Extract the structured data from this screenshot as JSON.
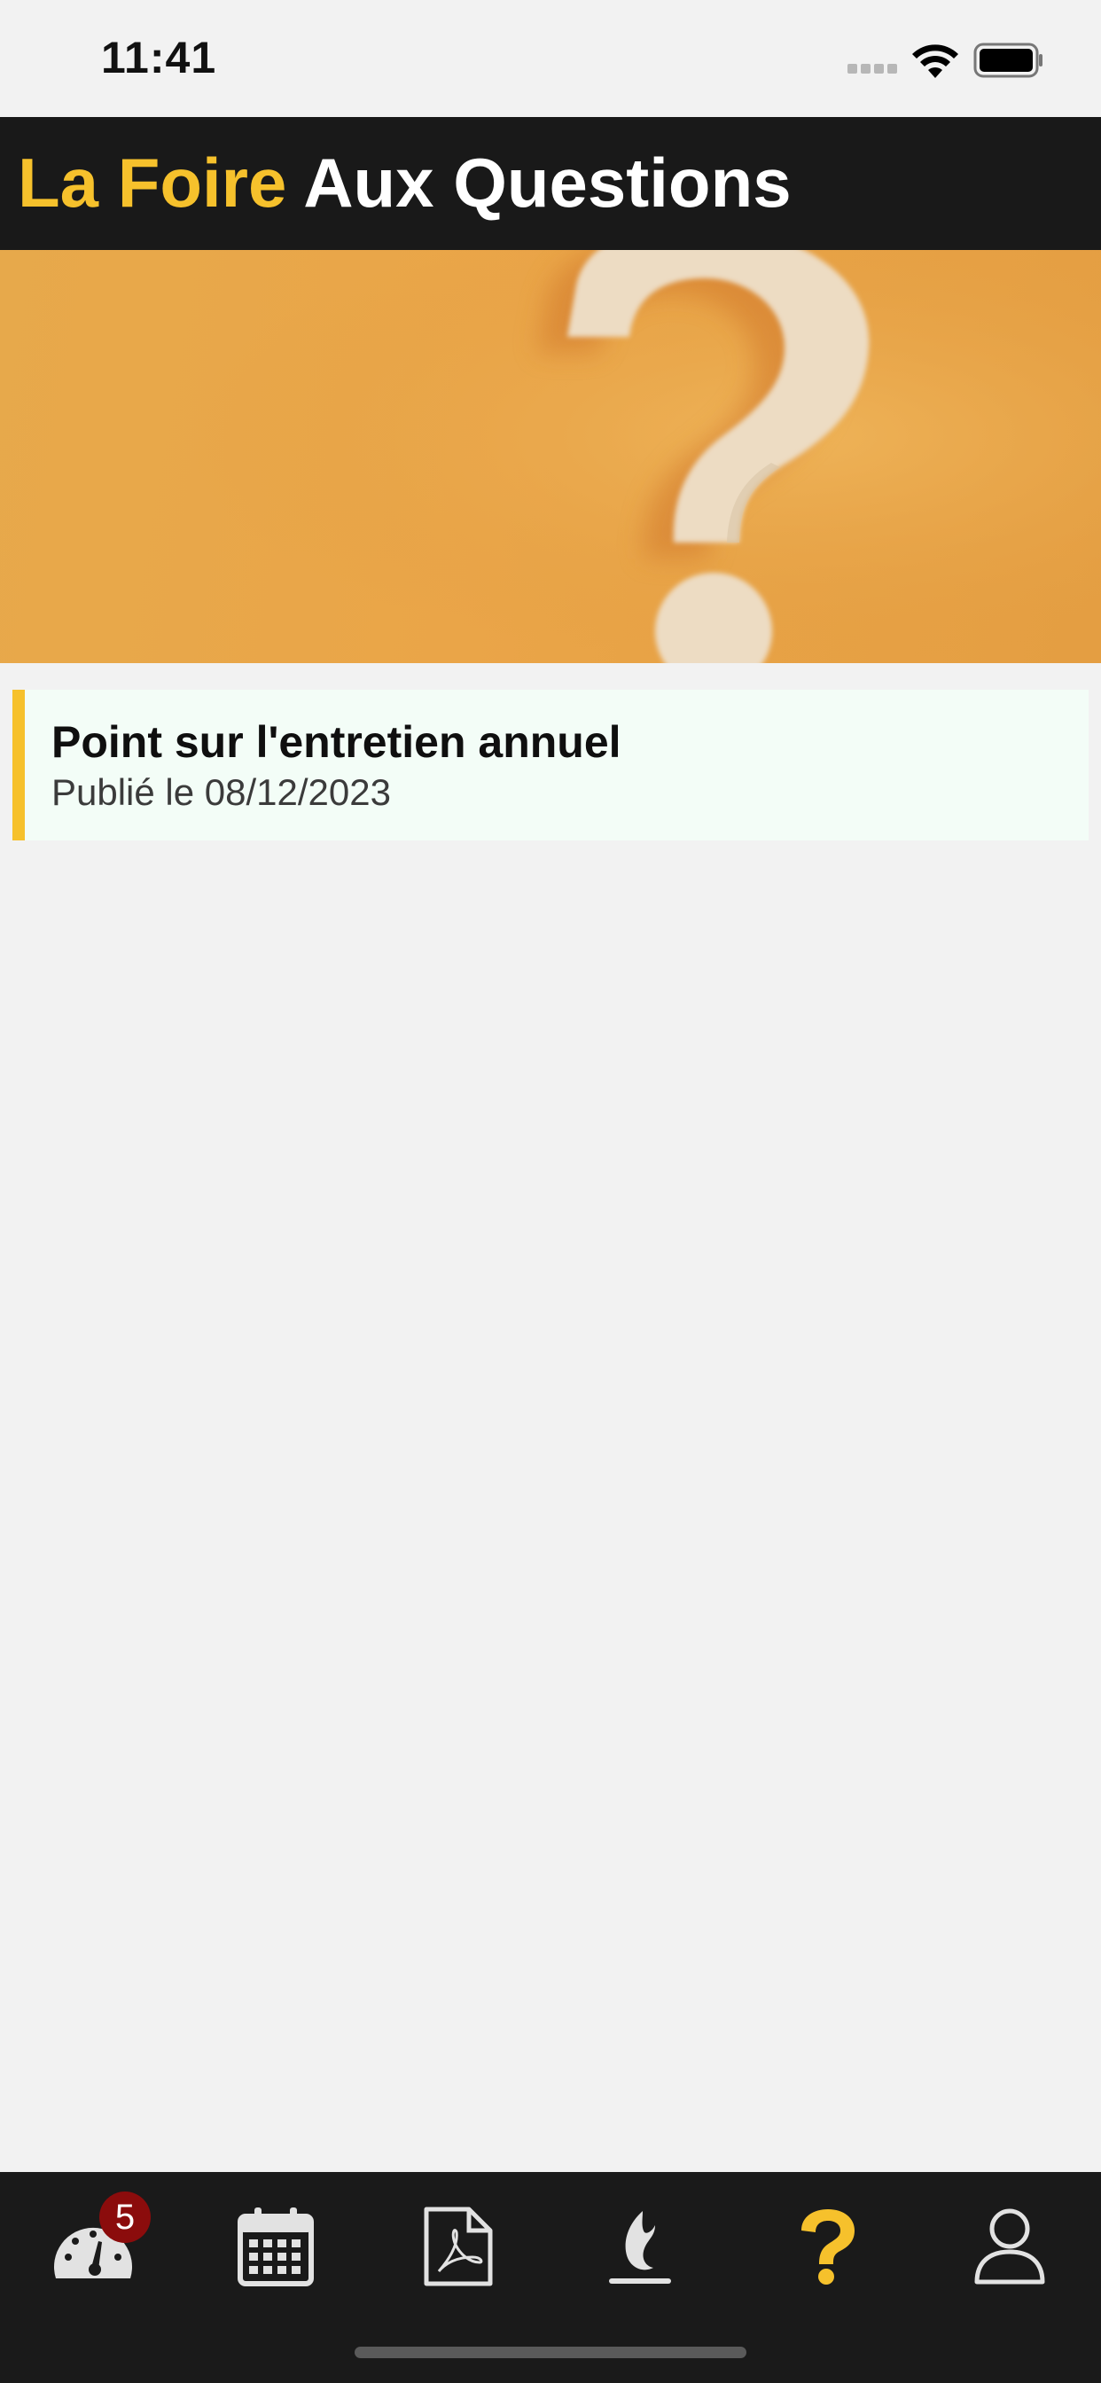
{
  "status_bar": {
    "time": "11:41"
  },
  "header": {
    "title_accent": "La Foire",
    "title_rest": "Aux Questions"
  },
  "faq_items": [
    {
      "title": "Point sur l'entretien annuel",
      "date": "Publié le 08/12/2023"
    }
  ],
  "tab_bar": {
    "tabs": [
      {
        "icon": "dashboard-icon",
        "badge": "5",
        "active": false
      },
      {
        "icon": "calendar-icon",
        "active": false
      },
      {
        "icon": "pdf-document-icon",
        "active": false
      },
      {
        "icon": "flame-icon",
        "active": false
      },
      {
        "icon": "question-mark-icon",
        "active": true
      },
      {
        "icon": "user-profile-icon",
        "active": false
      }
    ]
  },
  "colors": {
    "accent": "#f6c12c",
    "header_bg": "#191919",
    "badge": "#8b0c0c",
    "card_bg": "#f3fdf7"
  }
}
